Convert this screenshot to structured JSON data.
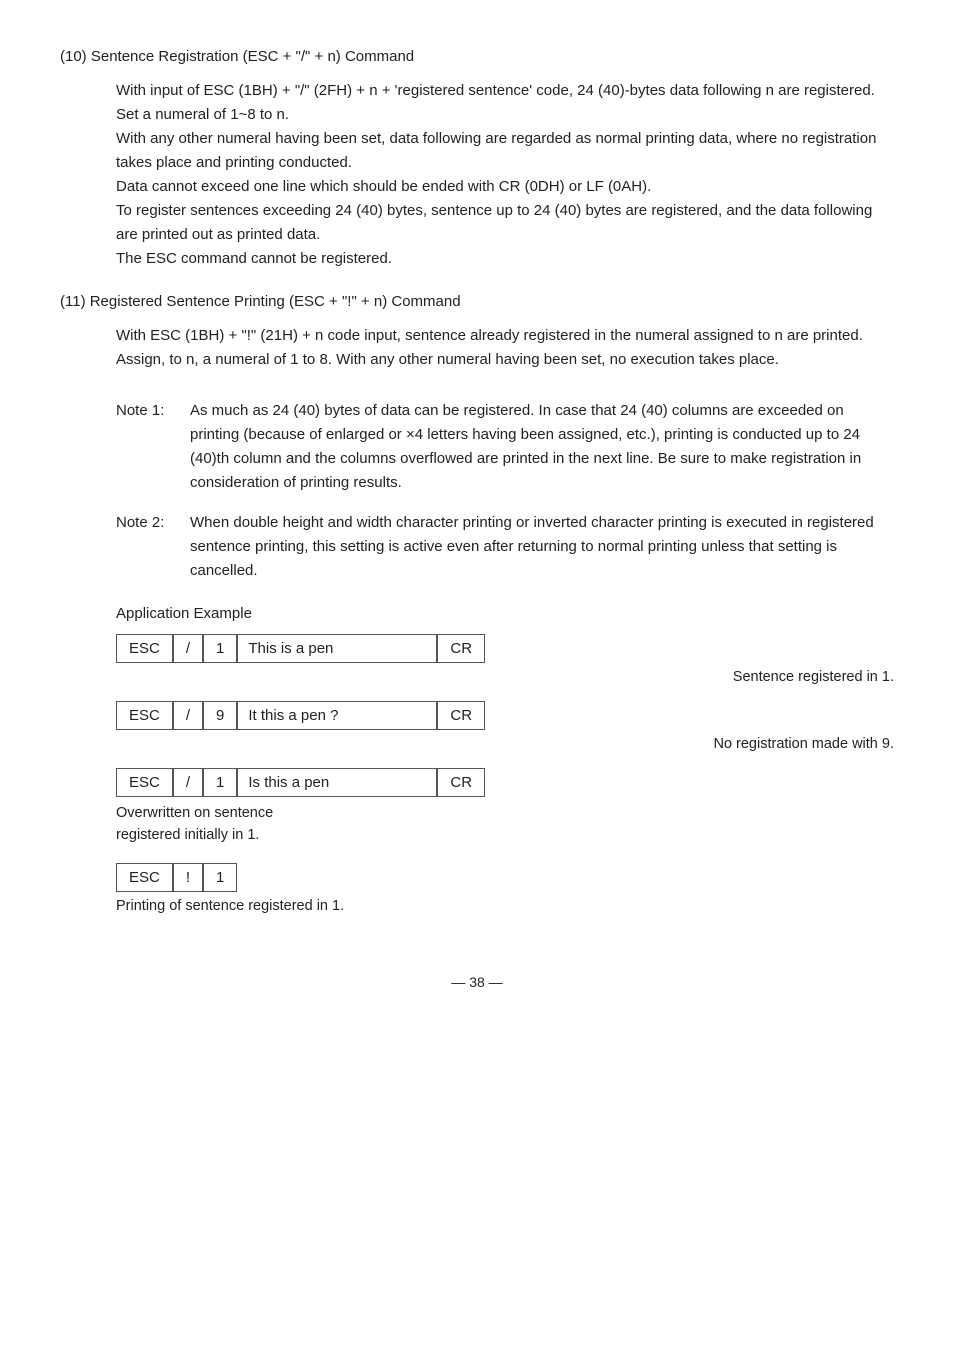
{
  "page": {
    "sections": [
      {
        "id": "s10",
        "title": "(10)  Sentence Registration (ESC + \"/\" + n) Command",
        "paragraphs": [
          "With input of ESC (1BH) + \"/\" (2FH) + n + 'registered sentence' code, 24 (40)-bytes data following n are registered.  Set a numeral of 1~8 to n.",
          "With any other numeral having been set, data following are regarded as normal printing data, where no registration takes place and printing conducted.",
          "Data cannot exceed one line which should be ended with CR (0DH) or LF (0AH).",
          "To register sentences exceeding 24 (40) bytes, sentence up to 24 (40) bytes are registered, and the data following are printed out as printed data.",
          "The ESC command cannot be registered."
        ]
      },
      {
        "id": "s11",
        "title": "(11)  Registered Sentence Printing (ESC + \"!\" + n) Command",
        "paragraphs": [
          "With ESC (1BH) + \"!\" (21H) + n code input, sentence already registered in the numeral assigned to n are printed.",
          "Assign, to n, a numeral of 1 to 8.  With any other numeral having been set, no execution takes place."
        ],
        "notes": [
          {
            "label": "Note 1:",
            "text": "As much as 24 (40) bytes of data can be registered.  In case that 24 (40) columns are exceeded on printing (because of enlarged or ×4 letters having been assigned, etc.), printing is conducted up to 24 (40)th column and the columns overflowed are printed in the next line.  Be sure to make registration in consideration of printing results."
          },
          {
            "label": "Note 2:",
            "text": "When double height and width character printing or inverted character printing is executed in registered sentence printing, this setting is active even after returning to normal printing unless that setting is cancelled."
          }
        ]
      }
    ],
    "app_example": {
      "label": "Application Example",
      "rows": [
        {
          "id": "row1",
          "cells": [
            "ESC",
            "/",
            "1",
            "This is a pen",
            "",
            "CR"
          ],
          "note": "Sentence registered in 1.",
          "note_align": "right"
        },
        {
          "id": "row2",
          "cells": [
            "ESC",
            "/",
            "9",
            "It this a pen ?",
            "",
            "CR"
          ],
          "note": "No registration made with 9.",
          "note_align": "right"
        },
        {
          "id": "row3",
          "cells": [
            "ESC",
            "/",
            "1",
            "Is this a pen",
            "",
            "CR"
          ],
          "note_line1": "Overwritten on sentence",
          "note_line2": "registered initially in 1.",
          "note_align": "left"
        },
        {
          "id": "row4",
          "cells": [
            "ESC",
            "!",
            "1"
          ],
          "note": "Printing of sentence registered in 1.",
          "note_align": "right"
        }
      ]
    },
    "footer": "— 38 —"
  }
}
